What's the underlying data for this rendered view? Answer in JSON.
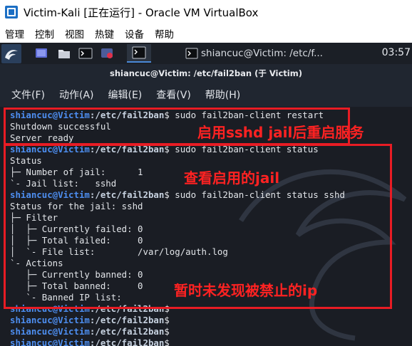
{
  "window": {
    "title": "Victim-Kali [正在运行] - Oracle VM VirtualBox",
    "menu": [
      "管理",
      "控制",
      "视图",
      "热键",
      "设备",
      "帮助"
    ]
  },
  "panel": {
    "task_label": "shiancuc@Victim: /etc/f...",
    "clock": "03:57"
  },
  "terminal": {
    "title": "shiancuc@Victim: /etc/fail2ban (于 Victim)",
    "menu": [
      "文件(F)",
      "动作(A)",
      "编辑(E)",
      "查看(V)",
      "帮助(H)"
    ],
    "prompt_user": "shiancuc@Victim",
    "prompt_path": ":/etc/fail2ban",
    "lines": [
      {
        "kind": "prompt",
        "cmd": "$ sudo fail2ban-client restart"
      },
      {
        "kind": "out",
        "text": "Shutdown successful"
      },
      {
        "kind": "out",
        "text": "Server ready"
      },
      {
        "kind": "prompt",
        "cmd": "$ sudo fail2ban-client status"
      },
      {
        "kind": "out",
        "text": "Status"
      },
      {
        "kind": "out",
        "text": "├─ Number of jail:      1"
      },
      {
        "kind": "out",
        "text": "`- Jail list:   sshd"
      },
      {
        "kind": "prompt",
        "cmd": "$ sudo fail2ban-client status sshd"
      },
      {
        "kind": "out",
        "text": "Status for the jail: sshd"
      },
      {
        "kind": "out",
        "text": "├─ Filter"
      },
      {
        "kind": "out",
        "text": "│  ├─ Currently failed: 0"
      },
      {
        "kind": "out",
        "text": "│  ├─ Total failed:     0"
      },
      {
        "kind": "out",
        "text": "│  `- File list:        /var/log/auth.log"
      },
      {
        "kind": "out",
        "text": "`- Actions"
      },
      {
        "kind": "out",
        "text": "   ├─ Currently banned: 0"
      },
      {
        "kind": "out",
        "text": "   ├─ Total banned:     0"
      },
      {
        "kind": "out",
        "text": "   `- Banned IP list:"
      },
      {
        "kind": "prompt",
        "cmd": "$"
      },
      {
        "kind": "prompt",
        "cmd": "$"
      },
      {
        "kind": "prompt",
        "cmd": "$"
      },
      {
        "kind": "prompt",
        "cmd": "$"
      }
    ]
  },
  "annotations": [
    {
      "text": "启用sshd jail后重启服务",
      "color": "#ff2222"
    },
    {
      "text": "查看启用的jail",
      "color": "#ff2222"
    },
    {
      "text": "暂时未发现被禁止的ip",
      "color": "#ff2222"
    }
  ]
}
